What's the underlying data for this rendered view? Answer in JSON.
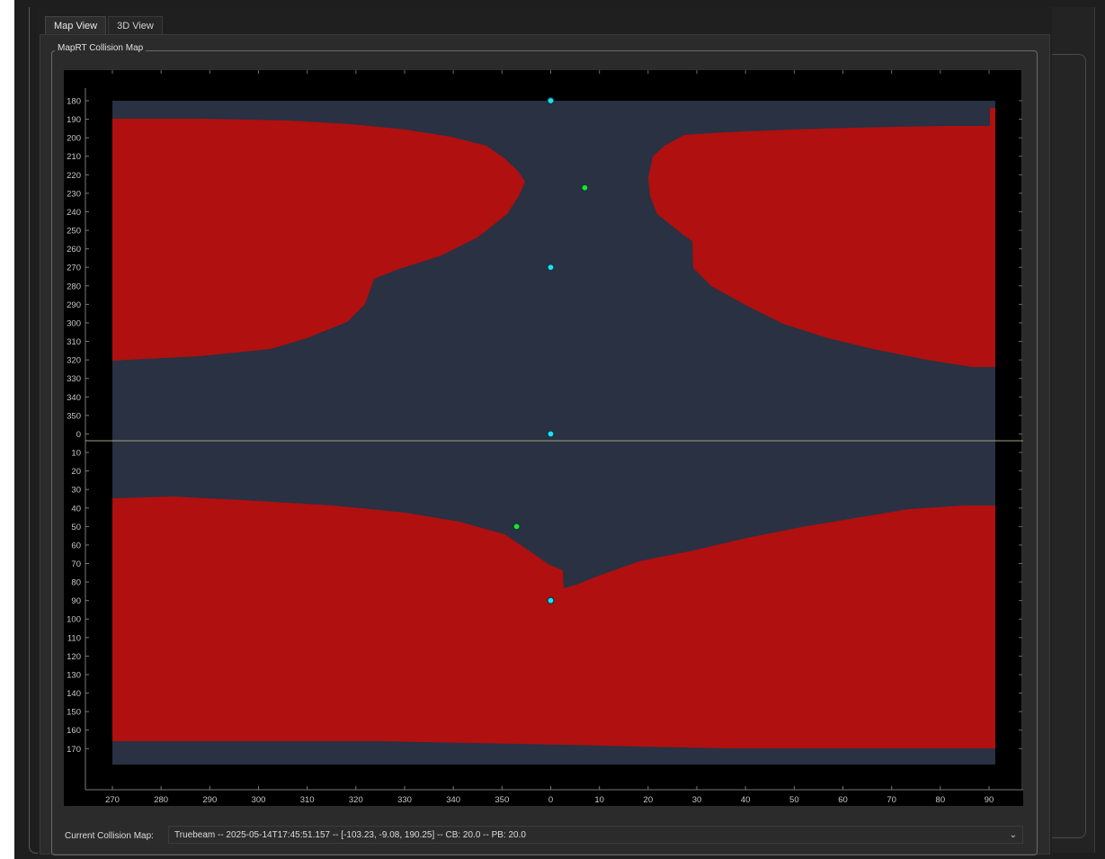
{
  "tabs": [
    {
      "label": "Map View",
      "active": true
    },
    {
      "label": "3D View",
      "active": false
    }
  ],
  "groupbox_title": "MapRT Collision Map",
  "footer": {
    "label": "Current Collision Map:",
    "selected_map": "Truebeam -- 2025-05-14T17:45:51.157 -- [-103.23, -9.08, 190.25] -- CB: 20.0 -- PB: 20.0",
    "dropdown_icon": "chevron-down-icon"
  },
  "colors": {
    "collision": "#b01010",
    "free": "#293142",
    "background": "#000000",
    "cyan_marker": "#1ee0f0",
    "green_marker": "#23e123",
    "zero_line": "#9ba57a"
  },
  "chart_data": {
    "type": "heatmap",
    "x_ticks": [
      "270",
      "280",
      "290",
      "300",
      "310",
      "320",
      "330",
      "340",
      "350",
      "0",
      "10",
      "20",
      "30",
      "40",
      "50",
      "60",
      "70",
      "80",
      "90"
    ],
    "y_ticks": [
      "180",
      "190",
      "200",
      "210",
      "220",
      "230",
      "240",
      "250",
      "260",
      "270",
      "280",
      "290",
      "300",
      "310",
      "320",
      "330",
      "340",
      "350",
      "0",
      "10",
      "20",
      "30",
      "40",
      "50",
      "60",
      "70",
      "80",
      "90",
      "100",
      "110",
      "120",
      "130",
      "140",
      "150",
      "160",
      "170"
    ],
    "xlim": [
      268,
      450
    ],
    "ylim_unwrapped": [
      180,
      540
    ],
    "zero_line_y": 360,
    "cyan_markers": [
      {
        "x": 0,
        "y": 180
      },
      {
        "x": 0,
        "y": 270
      },
      {
        "x": 0,
        "y": 0
      },
      {
        "x": 0,
        "y": 90
      }
    ],
    "green_markers": [
      {
        "x": 7,
        "y": 227
      },
      {
        "x": 353,
        "y": 50
      }
    ]
  }
}
